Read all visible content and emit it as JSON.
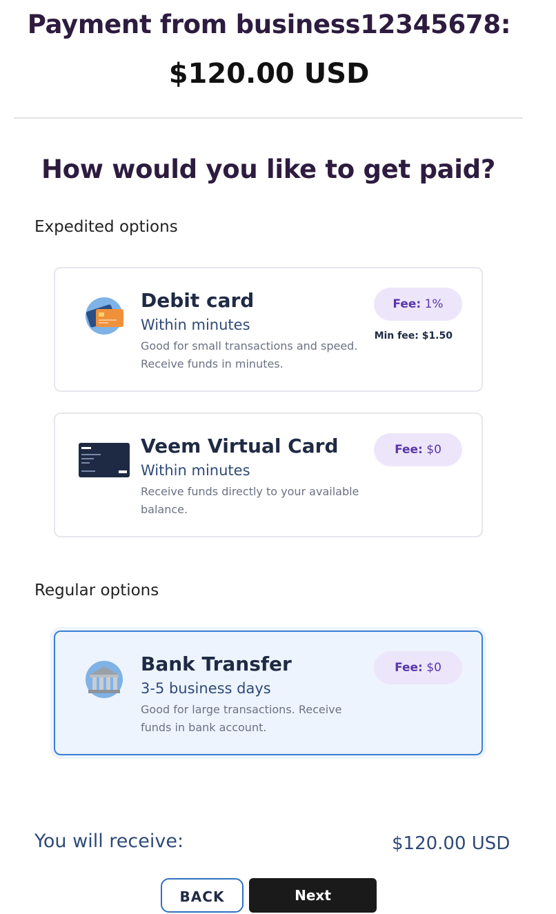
{
  "header": {
    "payment_title": "Payment from business12345678:",
    "amount": "$120.00 USD"
  },
  "question": "How would you like to get paid?",
  "sections": {
    "expedited_label": "Expedited options",
    "regular_label": "Regular options"
  },
  "options": [
    {
      "icon": "debit-card-icon",
      "title": "Debit card",
      "time": "Within minutes",
      "description": "Good for small transactions and speed. Receive funds in minutes.",
      "fee_label": "Fee:",
      "fee_value": "1%",
      "min_fee": "Min fee: $1.50",
      "selected": false
    },
    {
      "icon": "veem-virtual-card-icon",
      "title": "Veem Virtual Card",
      "time": "Within minutes",
      "description": "Receive funds directly to your available balance.",
      "fee_label": "Fee:",
      "fee_value": "$0",
      "selected": false
    },
    {
      "icon": "bank-icon",
      "title": "Bank Transfer",
      "time": "3-5 business days",
      "description": "Good for large transactions. Receive funds in bank account.",
      "fee_label": "Fee:",
      "fee_value": "$0",
      "selected": true
    }
  ],
  "summary": {
    "receive_label": "You will receive:",
    "receive_value": "$120.00 USD"
  },
  "buttons": {
    "back": "BACK",
    "next": "Next"
  },
  "colors": {
    "accent": "#3a7fd5",
    "fee_pill_bg": "#ede6fb",
    "fee_pill_text": "#5a37a7",
    "selected_bg": "#edf4fd"
  }
}
